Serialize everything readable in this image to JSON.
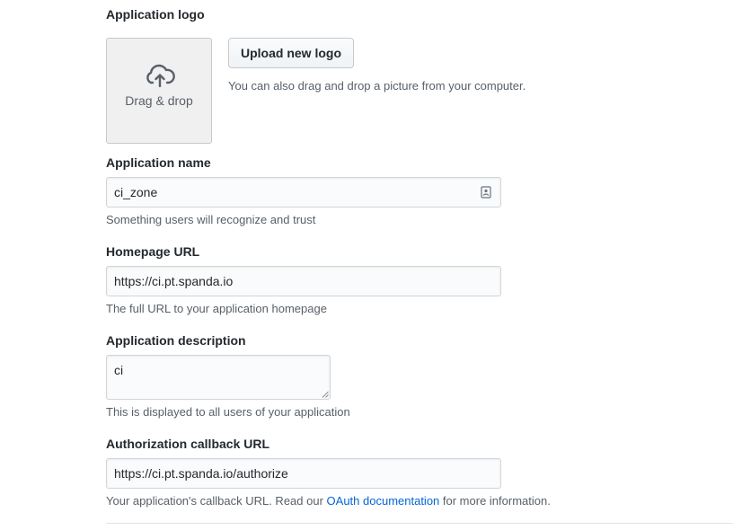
{
  "logo": {
    "label": "Application logo",
    "dropzone_text": "Drag & drop",
    "dropzone_icon": "cloud-upload-icon",
    "upload_button": "Upload new logo",
    "hint": "You can also drag and drop a picture from your computer."
  },
  "app_name": {
    "label": "Application name",
    "value": "ci_zone",
    "note": "Something users will recognize and trust",
    "field_icon": "contact-card-icon"
  },
  "homepage": {
    "label": "Homepage URL",
    "value": "https://ci.pt.spanda.io",
    "note": "The full URL to your application homepage"
  },
  "description": {
    "label": "Application description",
    "value": "ci",
    "note": "This is displayed to all users of your application"
  },
  "callback": {
    "label": "Authorization callback URL",
    "value": "https://ci.pt.spanda.io/authorize",
    "note_before": "Your application's callback URL. Read our ",
    "link_text": "OAuth documentation",
    "note_after": " for more information."
  },
  "colors": {
    "link": "#0366d6",
    "text": "#24292e",
    "muted": "#586069",
    "input_border": "#d1d5da"
  }
}
